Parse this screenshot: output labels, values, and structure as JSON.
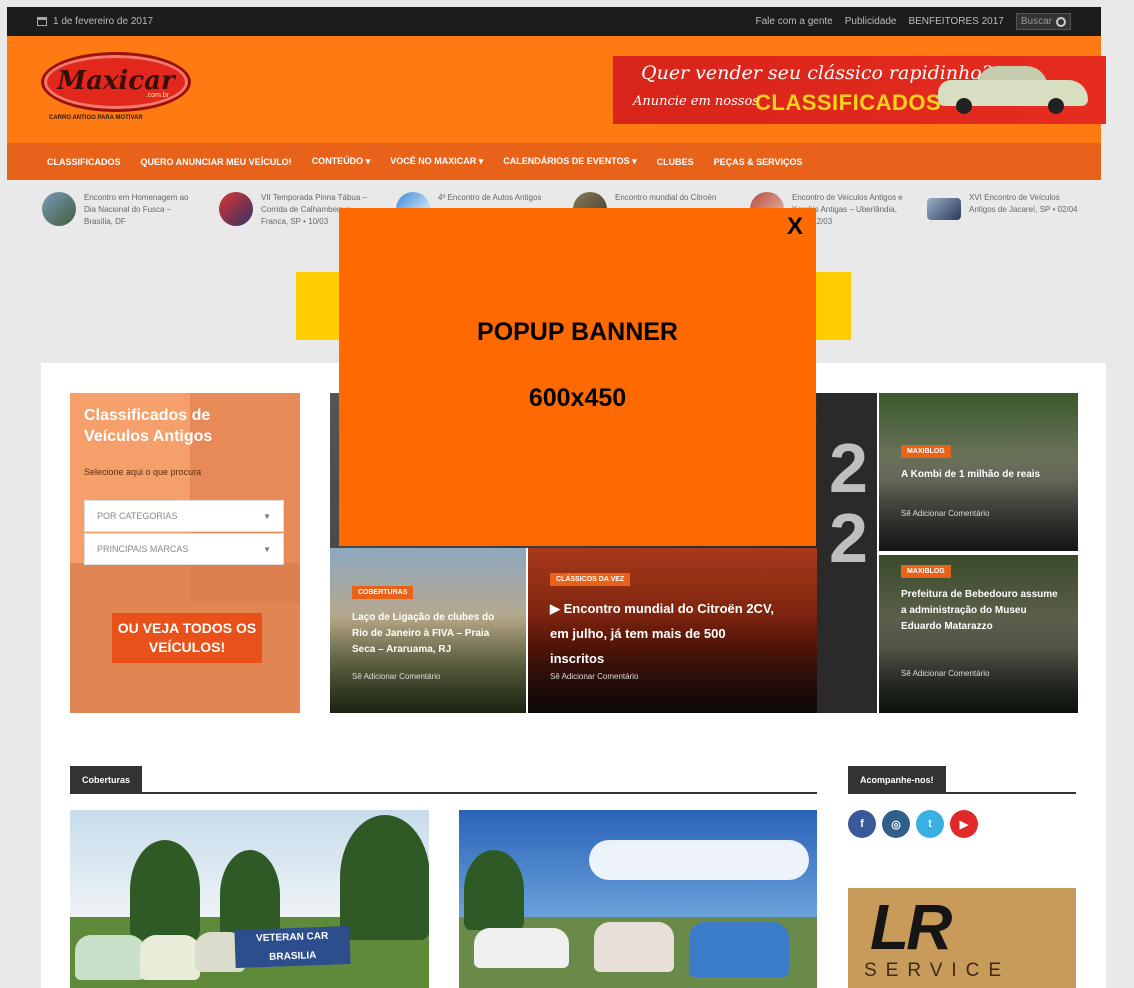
{
  "topbar": {
    "date": "1 de fevereiro de 2017",
    "links": [
      "Fale com a gente",
      "Publicidade",
      "BENFEITORES 2017"
    ],
    "search_label": "Buscar"
  },
  "header": {
    "logo_text": "Maxicar",
    "logo_domain": ".com.br",
    "logo_tagline": "CARRO ANTIGO PARA MOTIVAR",
    "ad_line1": "Quer vender seu clássico rapidinho?",
    "ad_line2": "Anuncie em nossos",
    "ad_line3": "CLASSIFICADOS"
  },
  "nav": {
    "items": [
      "CLASSIFICADOS",
      "QUERO ANUNCIAR MEU VEÍCULO!",
      "CONTEÚDO ▾",
      "VOCÊ NO MAXICAR ▾",
      "CALENDÁRIOS DE EVENTOS ▾",
      "CLUBES",
      "PEÇAS & SERVIÇOS"
    ]
  },
  "ticker": [
    "Encontro em Homenagem ao Dia Nacional do Fusca – Brasília, DF",
    "VII Temporada Pinna Tábua – Corrida de Calhambeque – Franca, SP • 10/03",
    "4º Encontro de Autos Antigos",
    "Encontro mundial do Citroën",
    "Encontro de Veículos Antigos e Kombis Antigas – Uberlândia, MG • 12/03",
    "XVI Encontro de Veículos Antigos de Jacareí, SP • 02/04"
  ],
  "classifieds": {
    "title": "Classificados de Veículos Antigos",
    "subtitle": "Selecione aqui o que procura",
    "dropdown1": "POR CATEGORIAS",
    "dropdown2": "PRINCIPAIS MARCAS",
    "button": "OU VEJA TODOS OS VEÍCULOS!"
  },
  "news": {
    "tile_left_badge": "COBERTURAS",
    "tile_left_title": "Laço de Ligação de clubes do Rio de Janeiro à FIVA – Praia Seca – Araruama, RJ",
    "tile_left_meta": "Sê Adicionar Comentário",
    "tile_center_badge": "CLÁSSICOS DA VEZ",
    "tile_center_title": "▶ Encontro mundial do Citroën 2CV, em julho, já tem mais de 500 inscritos",
    "tile_center_meta": "Sê Adicionar Comentário",
    "tile_rtop_badge": "MAXIBLOG",
    "tile_rtop_title": "A Kombi de 1 milhão de reais",
    "tile_rtop_meta": "Sê Adicionar Comentário",
    "tile_rbot_badge": "MAXIBLOG",
    "tile_rbot_title": "Prefeitura de Bebedouro assume a administração do Museu Eduardo Matarazzo",
    "tile_rbot_meta": "Sê Adicionar Comentário"
  },
  "sections": {
    "coberturas": "Coberturas",
    "acompanhe": "Acompanhe-nos!"
  },
  "sign_text": "VETERAN CAR BRASILIA",
  "social": [
    "f",
    "◎",
    "t",
    "▶"
  ],
  "lr_ad": {
    "logo": "LR",
    "service": "SERVICE"
  },
  "popup": {
    "close": "X",
    "title": "POPUP BANNER",
    "size": "600x450"
  },
  "colors": {
    "header_orange": "#ff7a12",
    "nav_orange": "#e8621a",
    "popup_orange": "#ff6a00",
    "yellow_ad": "#ffcc00",
    "facebook": "#3b5998",
    "instagram": "#2f5f8a",
    "twitter": "#3ab0e2",
    "youtube": "#e02a2a"
  }
}
